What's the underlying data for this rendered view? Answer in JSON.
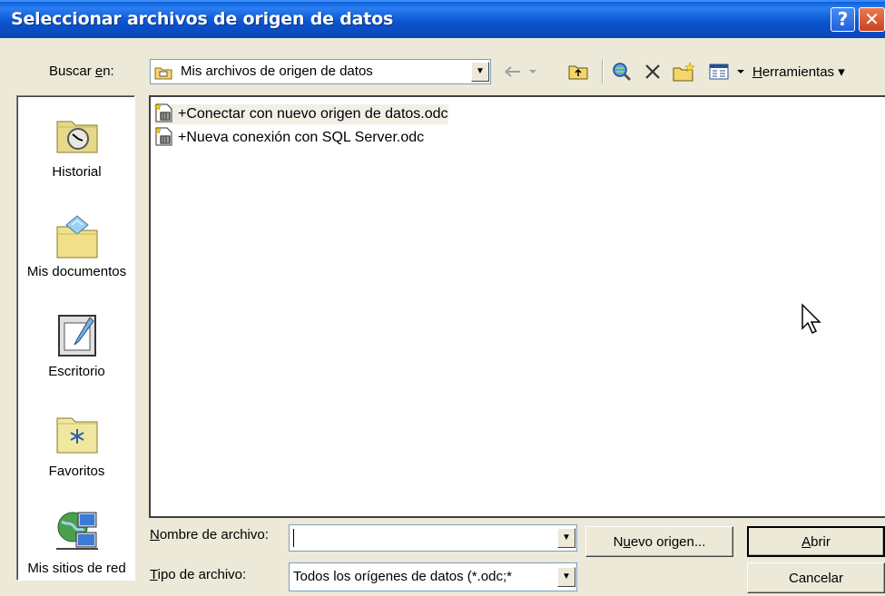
{
  "window": {
    "title": "Seleccionar archivos de origen de datos",
    "help_button": "?",
    "close_button": "✕"
  },
  "lookin": {
    "label_prefix": "Buscar ",
    "label_hotkey": "e",
    "label_suffix": "n:",
    "value": "Mis archivos de origen de datos",
    "icon": "folder-icon"
  },
  "toolbar": {
    "items": [
      "back-icon",
      "up-folder-icon",
      "search-web-icon",
      "delete-icon",
      "new-folder-icon",
      "views-icon"
    ],
    "tools_hotkey": "H",
    "tools_rest": "erramientas",
    "tools_arrow": "▾"
  },
  "places": [
    {
      "label": "Historial",
      "icon": "history-icon"
    },
    {
      "label": "Mis documentos",
      "icon": "my-documents-icon"
    },
    {
      "label": "Escritorio",
      "icon": "desktop-icon"
    },
    {
      "label": "Favoritos",
      "icon": "favorites-icon"
    },
    {
      "label": "Mis sitios de red",
      "icon": "network-places-icon"
    }
  ],
  "files": [
    {
      "name": "+Conectar con nuevo origen de datos.odc",
      "icon": "odc-file-icon",
      "selected": true
    },
    {
      "name": "+Nueva conexión con SQL Server.odc",
      "icon": "odc-file-icon",
      "selected": false
    }
  ],
  "filename": {
    "label_hotkey": "N",
    "label_rest": "ombre de archivo:",
    "value": ""
  },
  "filetype": {
    "label_hotkey": "T",
    "label_rest": "ipo de archivo:",
    "value": "Todos los orígenes de datos (*.odc;*"
  },
  "buttons": {
    "new_source_pre": "N",
    "new_source_hotkey": "u",
    "new_source_rest": "evo origen...",
    "open_hotkey": "A",
    "open_rest": "brir",
    "cancel": "Cancelar"
  }
}
